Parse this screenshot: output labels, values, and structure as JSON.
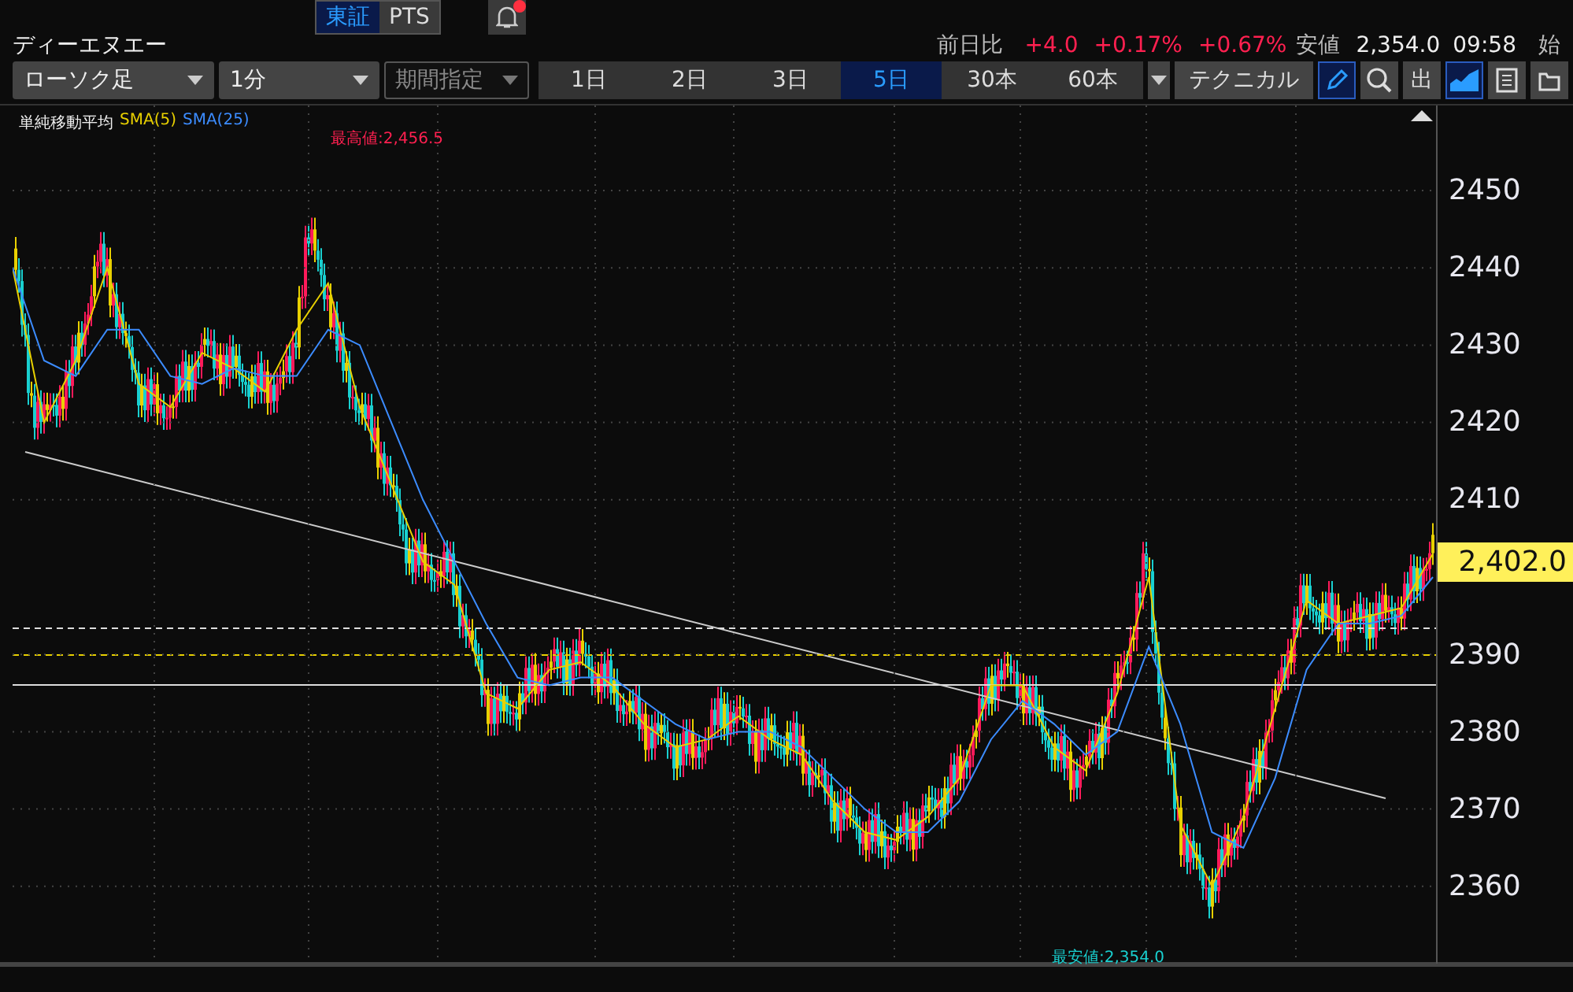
{
  "market_toggle": [
    {
      "label": "東証",
      "selected": true
    },
    {
      "label": "PTS",
      "selected": false
    }
  ],
  "notification": {
    "unread": true
  },
  "stock_name": "ディーエヌエー",
  "quote": {
    "change_label": "前日比",
    "change": "+4.0",
    "change_pct": "+0.17%",
    "change_pct_2": "+0.67%",
    "low_label": "安値",
    "low": "2,354.0",
    "low_time": "09:58",
    "open_label": "始"
  },
  "toolbar": {
    "chart_type": "ローソク足",
    "interval": "1分",
    "period": {
      "label": "期間指定",
      "disabled": true
    },
    "ranges": [
      {
        "label": "1日",
        "selected": false
      },
      {
        "label": "2日",
        "selected": false
      },
      {
        "label": "3日",
        "selected": false
      },
      {
        "label": "5日",
        "selected": true
      },
      {
        "label": "30本",
        "selected": false
      },
      {
        "label": "60本",
        "selected": false
      }
    ],
    "technical": "テクニカル",
    "tools": [
      {
        "kind": "pencil",
        "selected": true
      },
      {
        "kind": "magnifier",
        "selected": false
      },
      {
        "kind": "text",
        "label": "出",
        "selected": false
      },
      {
        "kind": "area",
        "selected": true
      },
      {
        "kind": "save",
        "selected": false
      },
      {
        "kind": "folder",
        "selected": false
      }
    ]
  },
  "chart": {
    "legend_title": "単純移動平均",
    "high_label": "最高値:2,456.5",
    "low_label": "最安値:2,354.0",
    "chart_data": {
      "type": "line",
      "grid": true,
      "ylim": [
        2350,
        2461
      ],
      "yticks": [
        2360,
        2370,
        2380,
        2390,
        2410,
        2420,
        2430,
        2440,
        2450
      ],
      "series": [
        {
          "name": "SMA(5)",
          "color": "#e8d000",
          "values": [
            2440,
            2420,
            2428,
            2440,
            2425,
            2422,
            2429,
            2427,
            2424,
            2432,
            2438,
            2422,
            2412,
            2402,
            2399,
            2385,
            2383,
            2388,
            2389,
            2386,
            2381,
            2378,
            2379,
            2382,
            2379,
            2377,
            2371,
            2367,
            2366,
            2369,
            2374,
            2386,
            2386,
            2378,
            2375,
            2385,
            2400,
            2368,
            2360,
            2369,
            2383,
            2397,
            2394,
            2395,
            2396,
            2403
          ]
        },
        {
          "name": "SMA(25)",
          "color": "#3c8cff",
          "values": [
            2440,
            2428,
            2426,
            2432,
            2432,
            2426,
            2425,
            2427,
            2426,
            2426,
            2432,
            2430,
            2420,
            2410,
            2402,
            2394,
            2387,
            2386,
            2387,
            2387,
            2384,
            2381,
            2379,
            2380,
            2380,
            2378,
            2374,
            2370,
            2367,
            2367,
            2371,
            2379,
            2384,
            2381,
            2377,
            2380,
            2391,
            2381,
            2367,
            2365,
            2374,
            2388,
            2394,
            2394,
            2395,
            2400
          ]
        }
      ]
    },
    "current_price": "2,402.0"
  }
}
